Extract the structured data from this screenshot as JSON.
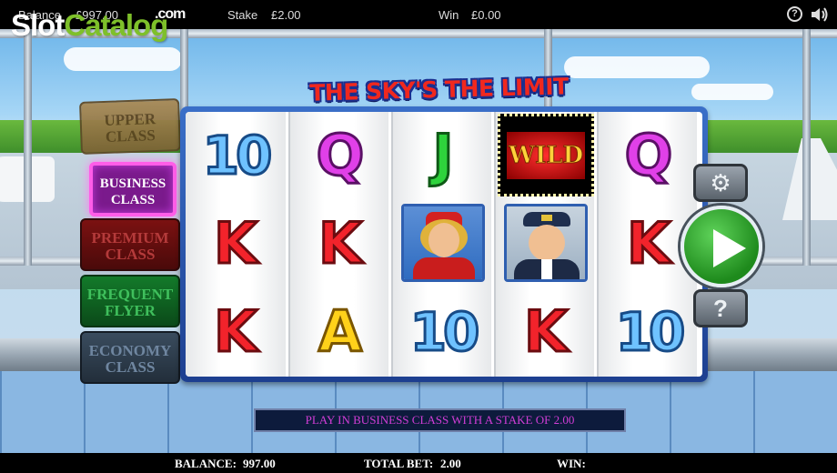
{
  "topbar": {
    "balance_label": "Balance",
    "balance_value": "£997.00",
    "stake_label": "Stake",
    "stake_value": "£2.00",
    "win_label": "Win",
    "win_value": "£0.00",
    "help_icon": "?",
    "sound_icon": "speaker-icon"
  },
  "watermark": {
    "part1": "Slot",
    "part2": "Catalog",
    "suffix": ".com"
  },
  "game_title": "THE SKY'S THE LIMIT",
  "class_buttons": [
    {
      "label_line1": "UPPER",
      "label_line2": "CLASS",
      "active": false
    },
    {
      "label_line1": "BUSINESS",
      "label_line2": "CLASS",
      "active": true
    },
    {
      "label_line1": "PREMIUM",
      "label_line2": "CLASS",
      "active": false
    },
    {
      "label_line1": "FREQUENT",
      "label_line2": "FLYER",
      "active": false
    },
    {
      "label_line1": "ECONOMY",
      "label_line2": "CLASS",
      "active": false
    }
  ],
  "reels": [
    [
      "10",
      "K",
      "K"
    ],
    [
      "Q",
      "K",
      "A"
    ],
    [
      "J",
      "stewardess",
      "10"
    ],
    [
      "WILD",
      "pilot",
      "K"
    ],
    [
      "Q",
      "K",
      "10"
    ]
  ],
  "controls": {
    "settings_icon": "gear-icon",
    "spin_icon": "play-icon",
    "help_label": "?"
  },
  "message": "PLAY IN BUSINESS CLASS WITH A STAKE OF 2.00",
  "bottombar": {
    "balance_label": "BALANCE:",
    "balance_value": "997.00",
    "total_bet_label": "TOTAL BET:",
    "total_bet_value": "2.00",
    "win_label": "WIN:"
  },
  "colors": {
    "spin_green": "#1e8a1c",
    "active_class": "#ff5de8",
    "title_red": "#f0281e"
  }
}
